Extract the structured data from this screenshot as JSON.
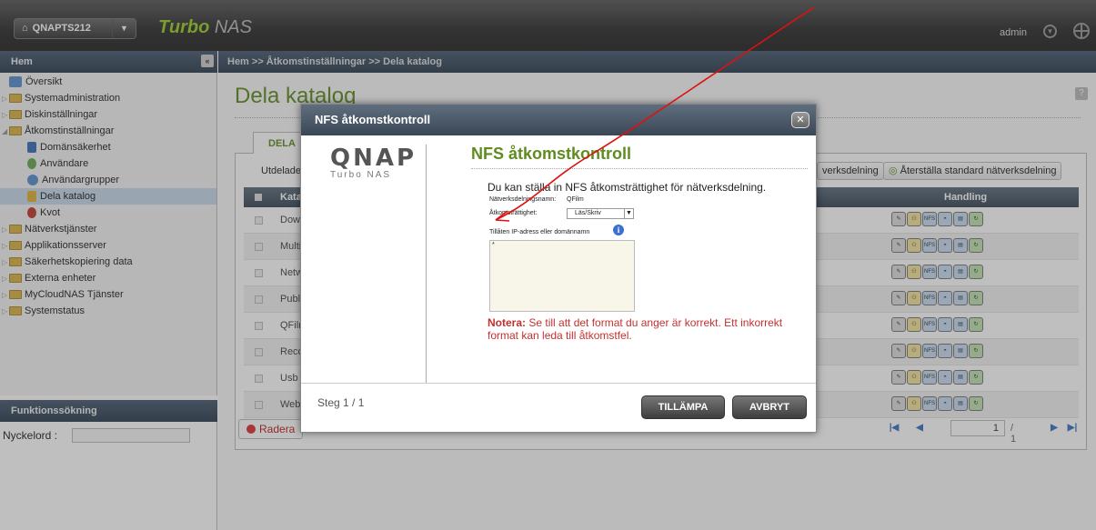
{
  "header": {
    "device_name": "QNAPTS212",
    "brand_turbo": "Turbo",
    "brand_nas": "NAS",
    "user": "admin"
  },
  "sidebar": {
    "title": "Hem",
    "items": [
      {
        "label": "Översikt"
      },
      {
        "label": "Systemadministration"
      },
      {
        "label": "Diskinställningar"
      },
      {
        "label": "Åtkomstinställningar"
      },
      {
        "label": "Domänsäkerhet"
      },
      {
        "label": "Användare"
      },
      {
        "label": "Användargrupper"
      },
      {
        "label": "Dela katalog"
      },
      {
        "label": "Kvot"
      },
      {
        "label": "Nätverkstjänster"
      },
      {
        "label": "Applikationsserver"
      },
      {
        "label": "Säkerhetskopiering data"
      },
      {
        "label": "Externa enheter"
      },
      {
        "label": "MyCloudNAS Tjänster"
      },
      {
        "label": "Systemstatus"
      }
    ],
    "function_search_title": "Funktionssökning",
    "keyword_label": "Nyckelord :"
  },
  "breadcrumb": "Hem >> Åtkomstinställningar >> Dela katalog",
  "page": {
    "title": "Dela katalog",
    "tab": "DELA",
    "toolbar_text": "Utdelade k",
    "btn_partial": "verksdelning",
    "btn_restore": "Återställa standard nätverksdelning",
    "col_name": "Kata",
    "col_action": "Handling",
    "rows": [
      "Dow",
      "Multi",
      "Netw",
      "Publ",
      "QFilr",
      "Recc",
      "Usb",
      "Web"
    ],
    "delete_label": "Radera",
    "pager_page": "1",
    "pager_of": "/ 1"
  },
  "dialog": {
    "header": "NFS åtkomstkontroll",
    "logo": "QNAP",
    "logo_sub": "Turbo NAS",
    "title": "NFS åtkomstkontroll",
    "intro": "Du kan ställa in NFS åtkomsträttighet för nätverksdelning.",
    "share_label": "Nätverksdelningsnamn:",
    "share_value": "QFilm",
    "access_label": "Åtkomsträttighet:",
    "access_value": "Läs/Skriv",
    "ip_label": "Tillåten IP-adress eller domännamn",
    "ip_value": "*",
    "note_bold": "Notera:",
    "note_text": " Se till att det format du anger är korrekt. Ett inkorrekt format kan leda till åtkomstfel.",
    "step": "Steg 1 / 1",
    "apply": "TILLÄMPA",
    "cancel": "AVBRYT"
  },
  "colors": {
    "accent_green": "#5f8c1f",
    "note_red": "#c43030",
    "annotation_red": "#e01010"
  }
}
